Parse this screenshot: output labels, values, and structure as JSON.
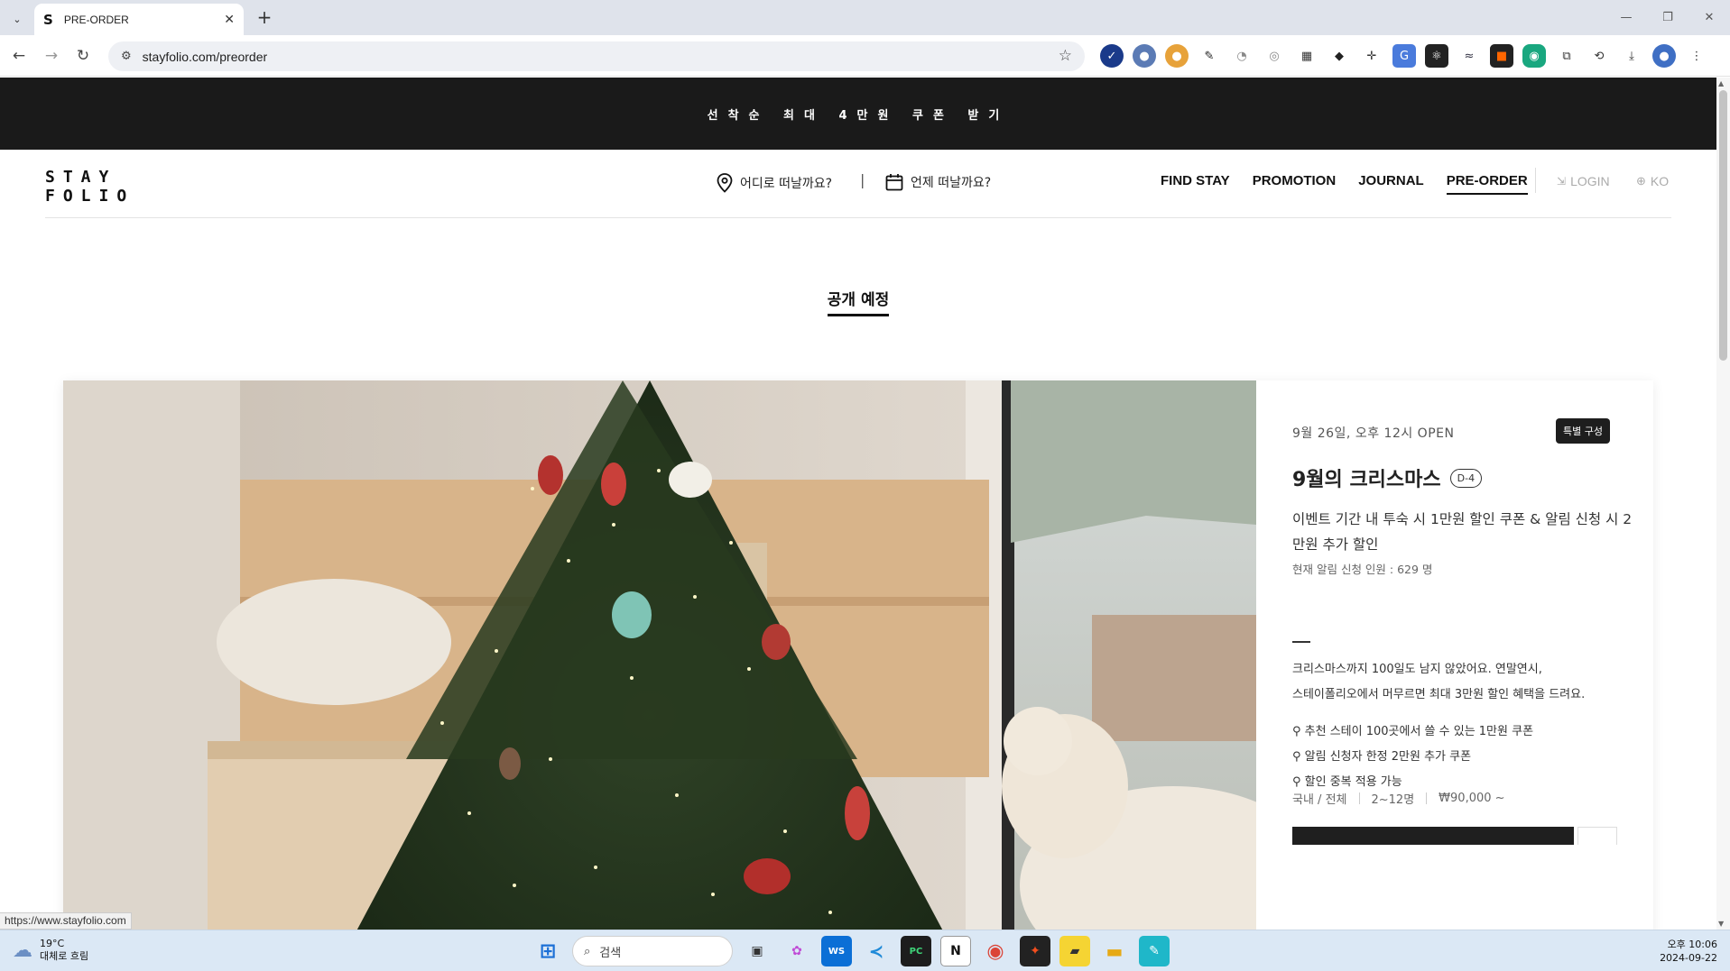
{
  "browser": {
    "tab_title": "PRE-ORDER",
    "tab_favicon": "S",
    "url": "stayfolio.com/preorder",
    "status_url": "https://www.stayfolio.com"
  },
  "page": {
    "banner_text": "선착순 최대 4만원 쿠폰 받기",
    "logo_line1": "STAY",
    "logo_line2": "FOLIO",
    "search_where": "어디로 떠날까요?",
    "search_sep": "|",
    "search_when": "언제 떠날까요?",
    "nav": [
      "FIND STAY",
      "PROMOTION",
      "JOURNAL",
      "PRE-ORDER"
    ],
    "login": "LOGIN",
    "lang": "KO",
    "section_title": "공개 예정"
  },
  "card": {
    "open_date": "9월 26일, 오후 12시 OPEN",
    "badge": "특별 구성",
    "name": "9월의 크리스마스",
    "dday": "D-4",
    "promo_desc": "이벤트 기간 내 투숙 시 1만원 할인 쿠폰 & 알림 신청 시 2만원 추가 할인",
    "applicants": "현재 알림 신청 인원 : 629 명",
    "body_line1": "크리스마스까지 100일도 남지 않았어요. 연말연시,",
    "body_line2": "스테이폴리오에서 머무르면 최대 3만원 할인 혜택을 드려요.",
    "benefits": [
      "⚲ 추천 스테이 100곳에서 쓸 수 있는 1만원 쿠폰",
      "⚲ 알림 신청자 한정 2만원 추가 쿠폰",
      "⚲ 할인 중복 적용 가능"
    ],
    "region": "국내 / 전체",
    "guests": "2~12명",
    "price": "₩90,000 ~"
  },
  "taskbar": {
    "temp": "19°C",
    "weather": "대체로 흐림",
    "search_label": "검색",
    "time": "오후 10:06",
    "date": "2024-09-22"
  }
}
